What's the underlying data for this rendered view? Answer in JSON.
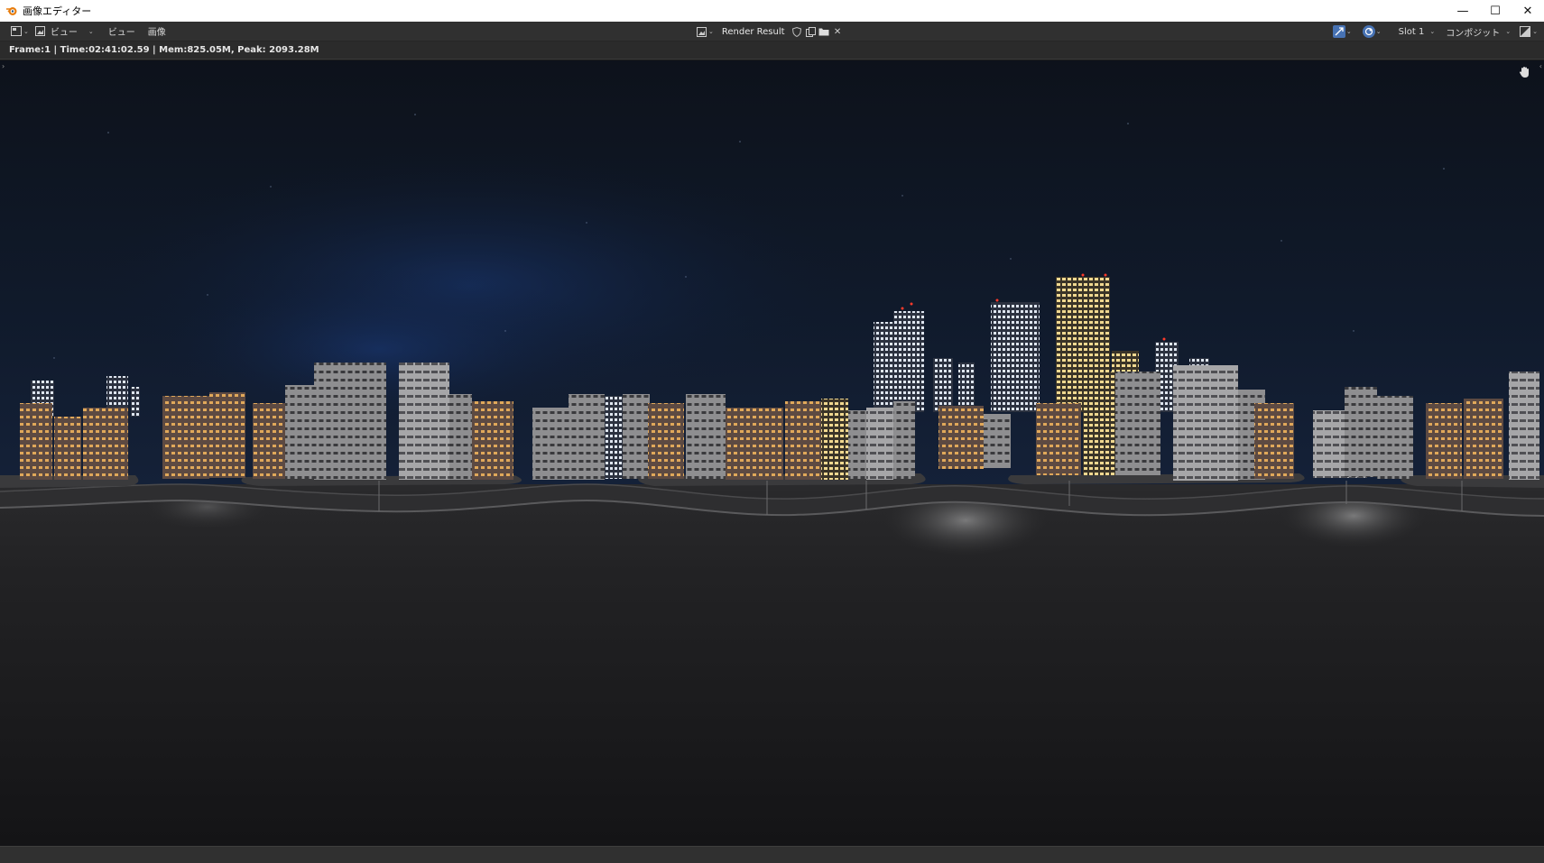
{
  "window": {
    "title": "画像エディター",
    "controls": {
      "minimize": "—",
      "maximize": "☐",
      "close": "✕"
    }
  },
  "header": {
    "menus": [
      "ビュー",
      "ビュー",
      "画像"
    ],
    "image_name": "Render Result",
    "slot": "Slot 1",
    "layer": "コンポジット"
  },
  "info": {
    "text": "Frame:1 | Time:02:41:02.59 | Mem:825.05M, Peak: 2093.28M"
  },
  "icons": {
    "editor_type": "image-editor-icon",
    "mode": "image-icon",
    "browse": "image-browse-icon",
    "fake_user": "shield-icon",
    "new": "duplicate-icon",
    "open": "folder-icon",
    "unlink": "close-icon",
    "gizmo": "gizmo-icon",
    "overlay": "overlay-icon",
    "display_channels": "display-channels-icon",
    "zoom": "zoom-icon",
    "pan": "hand-icon"
  },
  "colors": {
    "header_bg": "#303030",
    "accent_blue": "#4772b3",
    "sky_top": "#0f1520",
    "sky_horizon": "#111c2e"
  }
}
